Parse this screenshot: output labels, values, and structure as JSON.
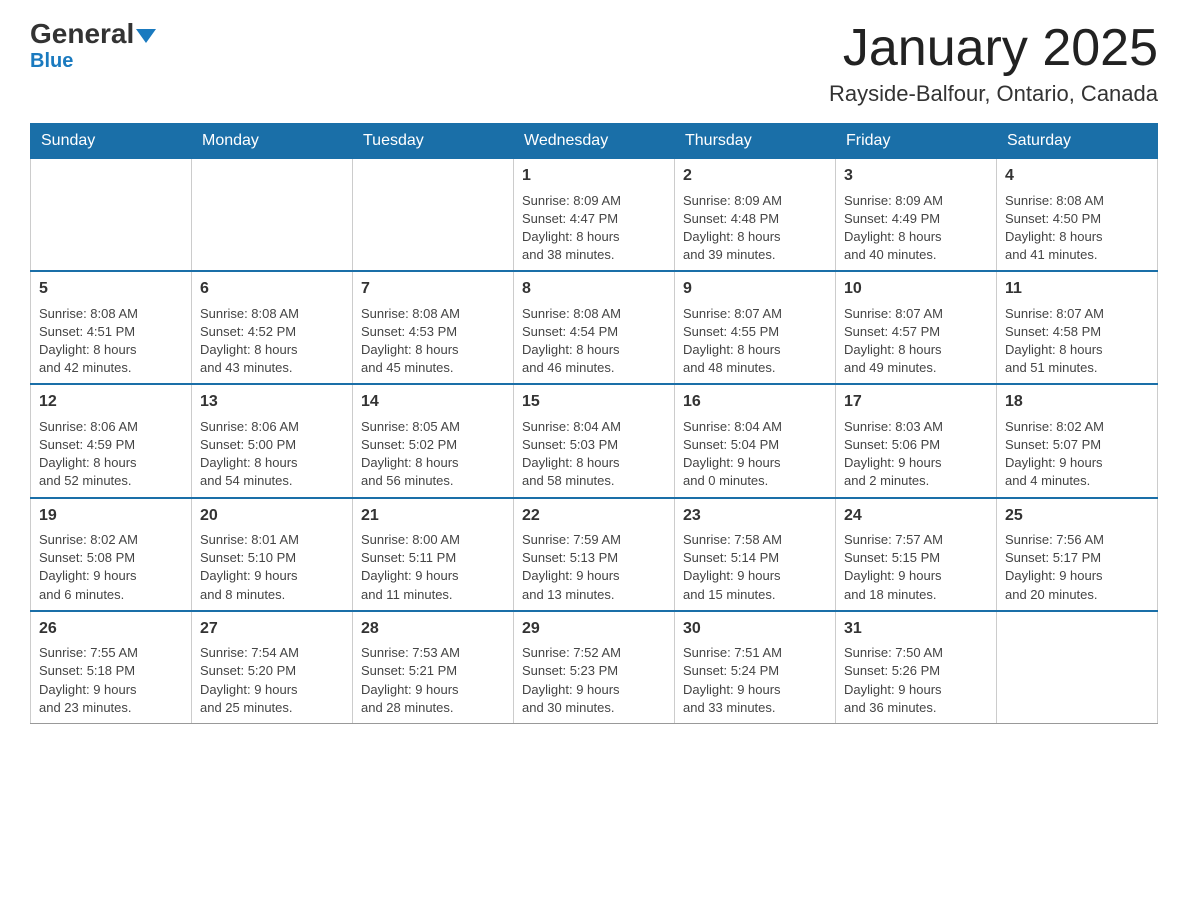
{
  "header": {
    "logo_main": "General",
    "logo_sub": "Blue",
    "month": "January 2025",
    "location": "Rayside-Balfour, Ontario, Canada"
  },
  "days_of_week": [
    "Sunday",
    "Monday",
    "Tuesday",
    "Wednesday",
    "Thursday",
    "Friday",
    "Saturday"
  ],
  "weeks": [
    [
      {
        "day": "",
        "info": ""
      },
      {
        "day": "",
        "info": ""
      },
      {
        "day": "",
        "info": ""
      },
      {
        "day": "1",
        "info": "Sunrise: 8:09 AM\nSunset: 4:47 PM\nDaylight: 8 hours\nand 38 minutes."
      },
      {
        "day": "2",
        "info": "Sunrise: 8:09 AM\nSunset: 4:48 PM\nDaylight: 8 hours\nand 39 minutes."
      },
      {
        "day": "3",
        "info": "Sunrise: 8:09 AM\nSunset: 4:49 PM\nDaylight: 8 hours\nand 40 minutes."
      },
      {
        "day": "4",
        "info": "Sunrise: 8:08 AM\nSunset: 4:50 PM\nDaylight: 8 hours\nand 41 minutes."
      }
    ],
    [
      {
        "day": "5",
        "info": "Sunrise: 8:08 AM\nSunset: 4:51 PM\nDaylight: 8 hours\nand 42 minutes."
      },
      {
        "day": "6",
        "info": "Sunrise: 8:08 AM\nSunset: 4:52 PM\nDaylight: 8 hours\nand 43 minutes."
      },
      {
        "day": "7",
        "info": "Sunrise: 8:08 AM\nSunset: 4:53 PM\nDaylight: 8 hours\nand 45 minutes."
      },
      {
        "day": "8",
        "info": "Sunrise: 8:08 AM\nSunset: 4:54 PM\nDaylight: 8 hours\nand 46 minutes."
      },
      {
        "day": "9",
        "info": "Sunrise: 8:07 AM\nSunset: 4:55 PM\nDaylight: 8 hours\nand 48 minutes."
      },
      {
        "day": "10",
        "info": "Sunrise: 8:07 AM\nSunset: 4:57 PM\nDaylight: 8 hours\nand 49 minutes."
      },
      {
        "day": "11",
        "info": "Sunrise: 8:07 AM\nSunset: 4:58 PM\nDaylight: 8 hours\nand 51 minutes."
      }
    ],
    [
      {
        "day": "12",
        "info": "Sunrise: 8:06 AM\nSunset: 4:59 PM\nDaylight: 8 hours\nand 52 minutes."
      },
      {
        "day": "13",
        "info": "Sunrise: 8:06 AM\nSunset: 5:00 PM\nDaylight: 8 hours\nand 54 minutes."
      },
      {
        "day": "14",
        "info": "Sunrise: 8:05 AM\nSunset: 5:02 PM\nDaylight: 8 hours\nand 56 minutes."
      },
      {
        "day": "15",
        "info": "Sunrise: 8:04 AM\nSunset: 5:03 PM\nDaylight: 8 hours\nand 58 minutes."
      },
      {
        "day": "16",
        "info": "Sunrise: 8:04 AM\nSunset: 5:04 PM\nDaylight: 9 hours\nand 0 minutes."
      },
      {
        "day": "17",
        "info": "Sunrise: 8:03 AM\nSunset: 5:06 PM\nDaylight: 9 hours\nand 2 minutes."
      },
      {
        "day": "18",
        "info": "Sunrise: 8:02 AM\nSunset: 5:07 PM\nDaylight: 9 hours\nand 4 minutes."
      }
    ],
    [
      {
        "day": "19",
        "info": "Sunrise: 8:02 AM\nSunset: 5:08 PM\nDaylight: 9 hours\nand 6 minutes."
      },
      {
        "day": "20",
        "info": "Sunrise: 8:01 AM\nSunset: 5:10 PM\nDaylight: 9 hours\nand 8 minutes."
      },
      {
        "day": "21",
        "info": "Sunrise: 8:00 AM\nSunset: 5:11 PM\nDaylight: 9 hours\nand 11 minutes."
      },
      {
        "day": "22",
        "info": "Sunrise: 7:59 AM\nSunset: 5:13 PM\nDaylight: 9 hours\nand 13 minutes."
      },
      {
        "day": "23",
        "info": "Sunrise: 7:58 AM\nSunset: 5:14 PM\nDaylight: 9 hours\nand 15 minutes."
      },
      {
        "day": "24",
        "info": "Sunrise: 7:57 AM\nSunset: 5:15 PM\nDaylight: 9 hours\nand 18 minutes."
      },
      {
        "day": "25",
        "info": "Sunrise: 7:56 AM\nSunset: 5:17 PM\nDaylight: 9 hours\nand 20 minutes."
      }
    ],
    [
      {
        "day": "26",
        "info": "Sunrise: 7:55 AM\nSunset: 5:18 PM\nDaylight: 9 hours\nand 23 minutes."
      },
      {
        "day": "27",
        "info": "Sunrise: 7:54 AM\nSunset: 5:20 PM\nDaylight: 9 hours\nand 25 minutes."
      },
      {
        "day": "28",
        "info": "Sunrise: 7:53 AM\nSunset: 5:21 PM\nDaylight: 9 hours\nand 28 minutes."
      },
      {
        "day": "29",
        "info": "Sunrise: 7:52 AM\nSunset: 5:23 PM\nDaylight: 9 hours\nand 30 minutes."
      },
      {
        "day": "30",
        "info": "Sunrise: 7:51 AM\nSunset: 5:24 PM\nDaylight: 9 hours\nand 33 minutes."
      },
      {
        "day": "31",
        "info": "Sunrise: 7:50 AM\nSunset: 5:26 PM\nDaylight: 9 hours\nand 36 minutes."
      },
      {
        "day": "",
        "info": ""
      }
    ]
  ]
}
